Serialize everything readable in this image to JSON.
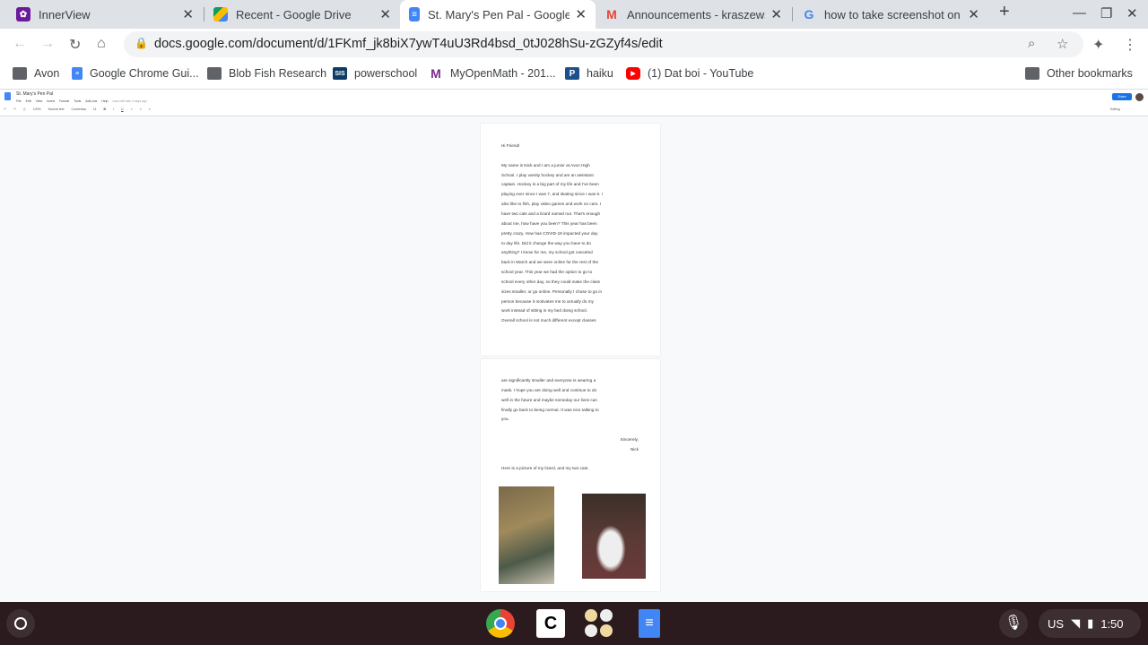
{
  "tabs": [
    {
      "title": "InnerView",
      "color": "#6a1b9a"
    },
    {
      "title": "Recent - Google Drive",
      "color": "#fbbc04"
    },
    {
      "title": "St. Mary's Pen Pal - Google Docs",
      "color": "#4285f4",
      "active": true
    },
    {
      "title": "Announcements - kraszewski",
      "color": "#ea4335"
    },
    {
      "title": "how to take screenshot on ch",
      "color": "#4285f4"
    }
  ],
  "address": {
    "url": "docs.google.com/document/d/1FKmf_jk8biX7ywT4uU3Rd4bsd_0tJ028hSu-zGZyf4s/edit"
  },
  "bookmarks": [
    {
      "label": "Avon",
      "icon": "folder-icon"
    },
    {
      "label": "Google Chrome Gui...",
      "icon": "docs-icon"
    },
    {
      "label": "Blob Fish Research",
      "icon": "folder-icon"
    },
    {
      "label": "powerschool",
      "icon": "sis-icon"
    },
    {
      "label": "MyOpenMath - 201...",
      "icon": "myopenmath-icon"
    },
    {
      "label": "haiku",
      "icon": "haiku-icon"
    },
    {
      "label": "(1) Dat boi - YouTube",
      "icon": "youtube-icon"
    }
  ],
  "other_bookmarks": "Other bookmarks",
  "doc": {
    "title": "St. Mary's Pen Pal",
    "menu": [
      "File",
      "Edit",
      "View",
      "Insert",
      "Format",
      "Tools",
      "Add-ons",
      "Help"
    ],
    "last_edit": "Last edit was 4 days ago",
    "zoom": "100%",
    "style": "Normal text",
    "font": "Comfortaa",
    "size": "11",
    "mode": "Editing",
    "share": "Share",
    "page1": [
      "Hi Friend!",
      "",
      "My name is Nick and I am a junior at Avon High",
      "School. I play varsity hockey and am an assistant",
      "captain. Hockey is a big part of my life and I've been",
      "playing ever since I was 7, and skating since I was 5. I",
      "also like to fish, play video games and work on cars. I",
      "have two cats and a lizard named nut. That's enough",
      "about me, how have you been? This year has been",
      "pretty crazy. How has COVID-19 impacted your day",
      "to day life. Did it change the way you have to do",
      "anything? I know for me, my school got canceled",
      "back in March and we were online for the rest of the",
      "school year. This year we had the option to go to",
      "school every other day, so they could make the class",
      "sizes smaller, or go online. Personally I chose to go in",
      "person because it motivates me to actually do my",
      "work instead of sitting in my bed doing school.",
      "Overall school is not much different except classes"
    ],
    "page2": [
      "are significantly smaller and everyone is wearing a",
      "mask. I hope you are doing well and continue to do",
      "well in the future and maybe someday our lives can",
      "finally go back to being normal. It was nice talking to",
      "you."
    ],
    "closing": "Sincerely,",
    "signature": "Nick",
    "picture_caption": "Here is a picture of my lizard, and my two cats."
  },
  "tray": {
    "locale": "US",
    "time": "1:50"
  }
}
